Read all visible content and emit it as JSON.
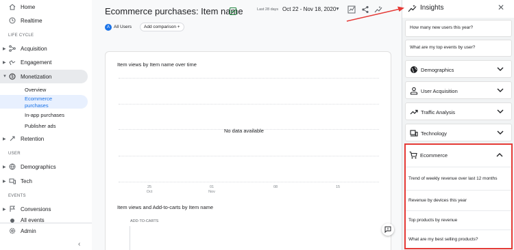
{
  "sidebar": {
    "home": "Home",
    "realtime": "Realtime",
    "section_lifecycle": "LIFE CYCLE",
    "acquisition": "Acquisition",
    "engagement": "Engagement",
    "monetization": "Monetization",
    "overview": "Overview",
    "ecommerce_purchases": "Ecommerce purchases",
    "in_app_purchases": "In-app purchases",
    "publisher_ads": "Publisher ads",
    "retention": "Retention",
    "section_user": "USER",
    "demographics": "Demographics",
    "tech": "Tech",
    "section_events": "EVENTS",
    "conversions": "Conversions",
    "all_events": "All events",
    "admin": "Admin"
  },
  "header": {
    "title": "Ecommerce purchases: Item name",
    "date_prefix": "Last 28 days",
    "date_range": "Oct 22 - Nov 18, 2020"
  },
  "filters": {
    "avatar_letter": "A",
    "all_users": "All Users",
    "add_comparison": "Add comparison +"
  },
  "chart1": {
    "title": "Item views by Item name over time",
    "empty_message": "No data available",
    "x_ticks": [
      {
        "day": "25",
        "month": "Oct"
      },
      {
        "day": "01",
        "month": "Nov"
      },
      {
        "day": "08",
        "month": ""
      },
      {
        "day": "15",
        "month": ""
      }
    ]
  },
  "chart2": {
    "title": "Item views and Add-to-carts by Item name",
    "column_label": "ADD-TO-CARTS"
  },
  "insights": {
    "title": "Insights",
    "questions": [
      "How many new users this year?",
      "What are my top events by user?"
    ],
    "sections": [
      {
        "label": "Demographics",
        "icon": "globe-icon"
      },
      {
        "label": "User Acquisition",
        "icon": "person-icon"
      },
      {
        "label": "Traffic Analysis",
        "icon": "trend-icon"
      },
      {
        "label": "Technology",
        "icon": "devices-icon"
      }
    ],
    "ecommerce": {
      "label": "Ecommerce",
      "items": [
        "Trend of weekly revenue over last 12 months",
        "Revenue by devices this year",
        "Top products by revenue",
        "What are my best selling products?"
      ]
    }
  },
  "colors": {
    "accent": "#1a73e8",
    "highlight_border": "#e53935",
    "arrow": "#e53935"
  }
}
